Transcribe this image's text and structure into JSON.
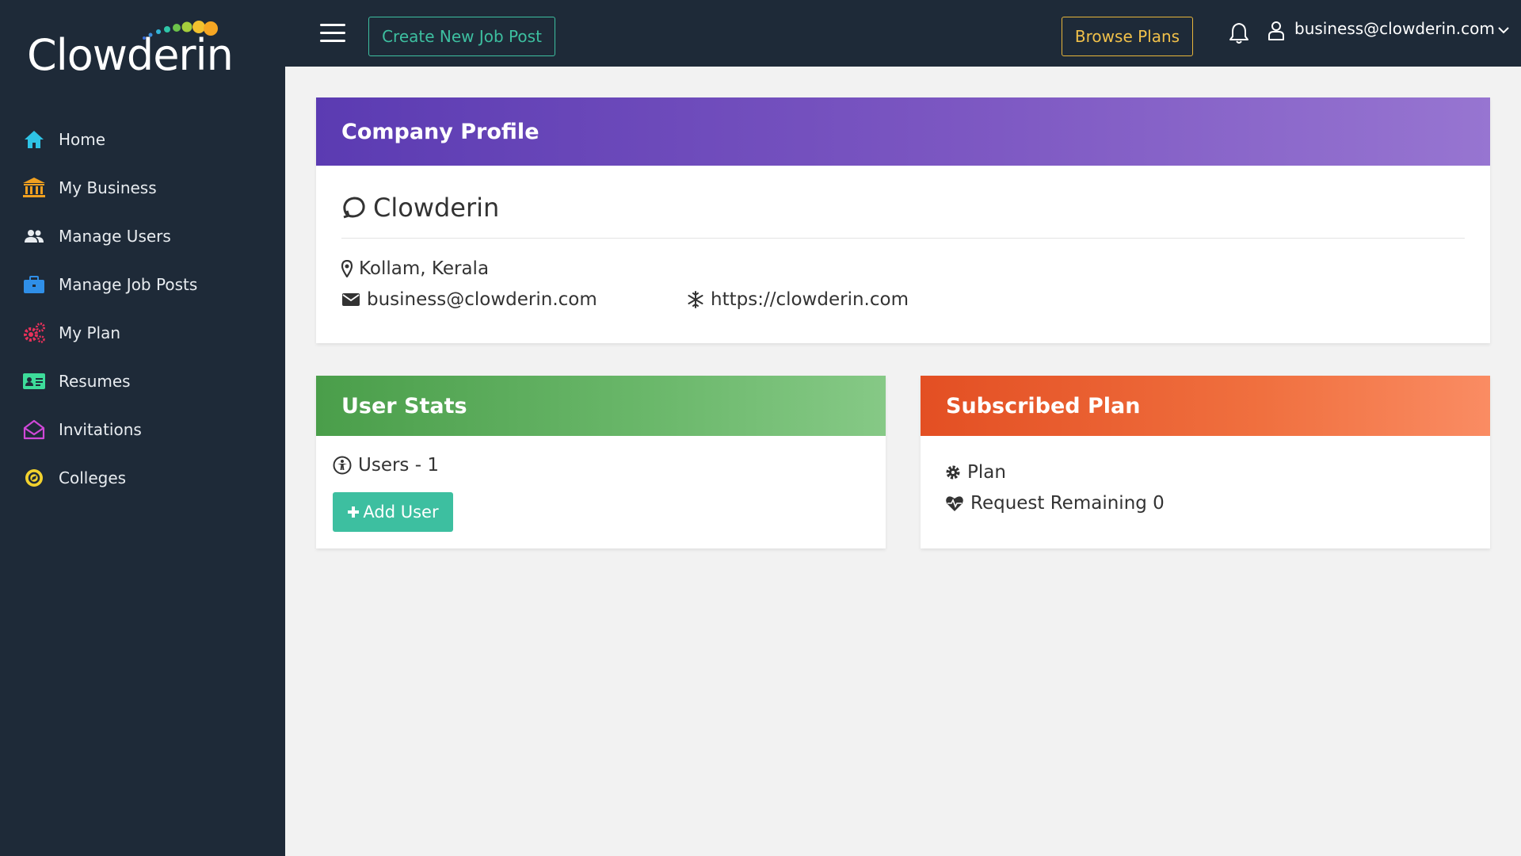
{
  "brand": {
    "name": "Clowderin"
  },
  "sidebar": {
    "items": [
      {
        "label": "Home",
        "icon": "home-icon",
        "color": "#2ec4e6"
      },
      {
        "label": "My Business",
        "icon": "bank-icon",
        "color": "#f0a020"
      },
      {
        "label": "Manage Users",
        "icon": "users-icon",
        "color": "#e8ecf0"
      },
      {
        "label": "Manage Job Posts",
        "icon": "briefcase-icon",
        "color": "#2f8fe8"
      },
      {
        "label": "My Plan",
        "icon": "gears-icon",
        "color": "#e8315a"
      },
      {
        "label": "Resumes",
        "icon": "id-card-icon",
        "color": "#3ddc9a"
      },
      {
        "label": "Invitations",
        "icon": "envelope-open-icon",
        "color": "#d048d8"
      },
      {
        "label": "Colleges",
        "icon": "compass-icon",
        "color": "#f2d22e"
      }
    ]
  },
  "topbar": {
    "create_label": "Create New Job Post",
    "browse_label": "Browse Plans",
    "user_email": "business@clowderin.com"
  },
  "profile": {
    "title": "Company Profile",
    "company_name": "Clowderin",
    "location": "Kollam, Kerala",
    "email": "business@clowderin.com",
    "website": "https://clowderin.com"
  },
  "user_stats": {
    "title": "User Stats",
    "users_text": "Users - 1",
    "add_label": "Add User"
  },
  "subscribed_plan": {
    "title": "Subscribed Plan",
    "plan_text": "Plan",
    "remaining_text": "Request Remaining 0"
  },
  "colors": {
    "sidebar_bg": "#1e2a38",
    "accent_teal": "#3dbfa0",
    "accent_gold": "#f0c04a"
  }
}
